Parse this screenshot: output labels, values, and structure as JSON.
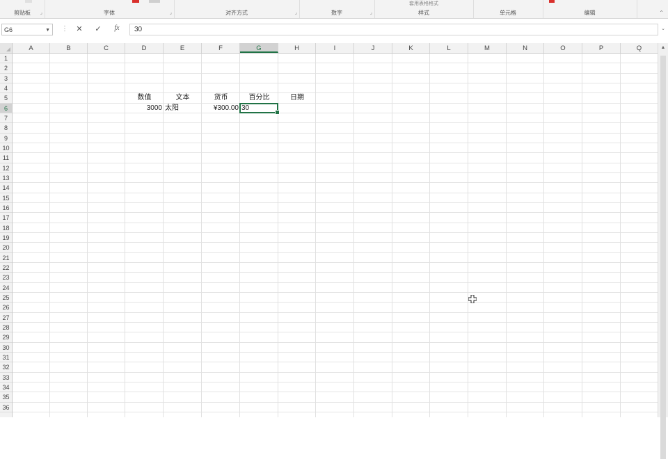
{
  "ribbon": {
    "groups": [
      {
        "label": "剪贴板",
        "launcher": true
      },
      {
        "label": "字体",
        "launcher": true
      },
      {
        "label": "对齐方式",
        "launcher": true
      },
      {
        "label": "数字",
        "launcher": true
      },
      {
        "label": "样式",
        "top_text": "套用表格格式",
        "launcher": false
      },
      {
        "label": "单元格",
        "launcher": false
      },
      {
        "label": "编辑",
        "launcher": false
      }
    ]
  },
  "formula_bar": {
    "name_box": "G6",
    "content": "30",
    "cancel_glyph": "✕",
    "enter_glyph": "✓",
    "fx_glyph": "fx"
  },
  "sheet": {
    "columns": [
      "A",
      "B",
      "C",
      "D",
      "E",
      "F",
      "G",
      "H",
      "I",
      "J",
      "K",
      "L",
      "M",
      "N",
      "O",
      "P",
      "Q"
    ],
    "rows": [
      "1",
      "2",
      "3",
      "4",
      "5",
      "6",
      "7",
      "8",
      "9",
      "10",
      "11",
      "12",
      "13",
      "14",
      "15",
      "16",
      "17",
      "18",
      "19",
      "20",
      "21",
      "22",
      "23",
      "24",
      "25",
      "26",
      "27",
      "28",
      "29",
      "30",
      "31",
      "32",
      "33",
      "34",
      "35",
      "36"
    ],
    "active_column": "G",
    "active_row": "6",
    "cells": {
      "D5": "数值",
      "E5": "文本",
      "F5": "货币",
      "G5": "百分比",
      "H5": "日期",
      "D6": "3000",
      "E6": "太阳",
      "F6": "¥300.00",
      "G6": "30"
    }
  },
  "colors": {
    "accent": "#217346",
    "grid": "#e2e2e2",
    "header_bg": "#f2f2f2"
  }
}
